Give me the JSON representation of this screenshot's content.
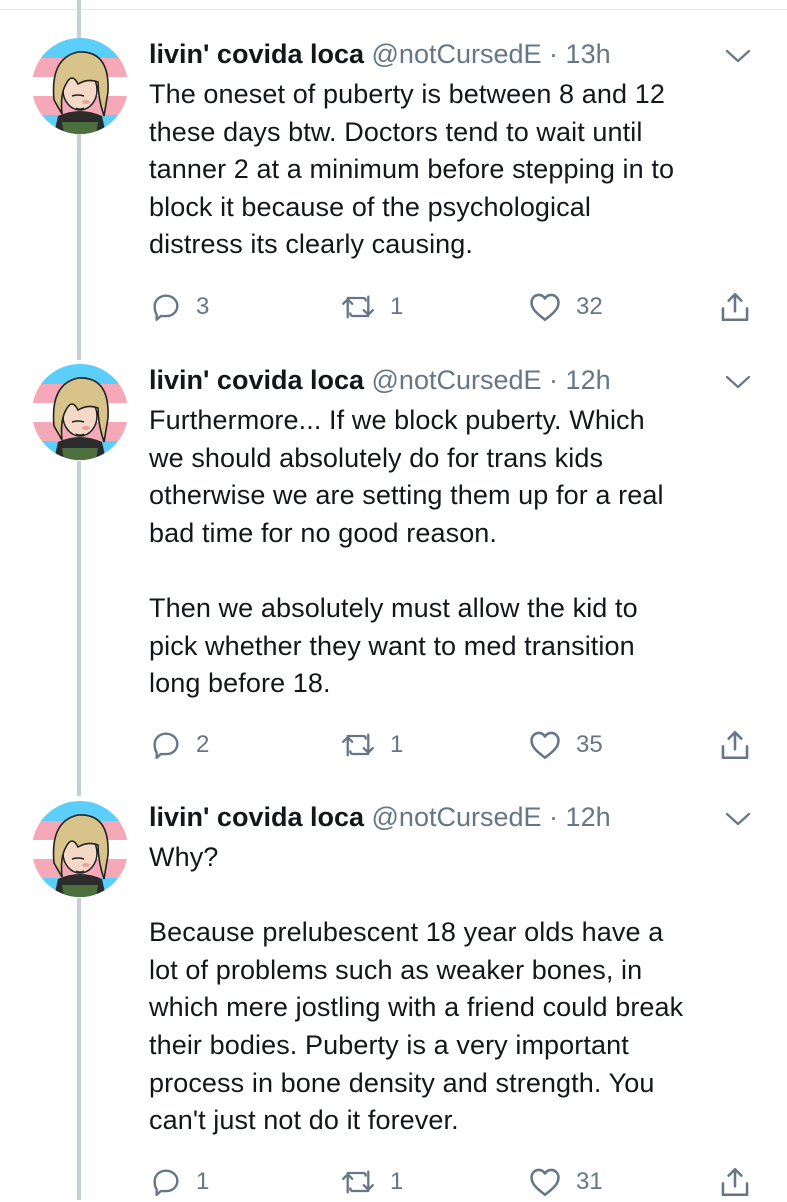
{
  "tweets": [
    {
      "name": "livin' covida loca",
      "handle": "@notCursedE",
      "separator": "·",
      "time": "13h",
      "text": "The oneset of puberty is between 8 and 12\nthese days btw. Doctors tend to wait until\ntanner 2 at a minimum before stepping in to\nblock it because of the psychological\ndistress its clearly causing.",
      "replies": "3",
      "retweets": "1",
      "likes": "32"
    },
    {
      "name": "livin' covida loca",
      "handle": "@notCursedE",
      "separator": "·",
      "time": "12h",
      "text": "Furthermore... If we block puberty. Which\nwe should absolutely do for trans kids\notherwise we are setting them up for a real\nbad time for no good reason.\n\nThen we absolutely must allow the kid to\npick whether they want to med transition\nlong before 18.",
      "replies": "2",
      "retweets": "1",
      "likes": "35"
    },
    {
      "name": "livin' covida loca",
      "handle": "@notCursedE",
      "separator": "·",
      "time": "12h",
      "text": "Why?\n\nBecause prelubescent 18 year olds have a\nlot of problems such as weaker bones, in\nwhich mere jostling with a friend could break\ntheir bodies. Puberty is a very important\nprocess in bone density and strength. You\ncan't just not do it forever.",
      "replies": "1",
      "retweets": "1",
      "likes": "31"
    }
  ],
  "icons": {
    "reply": "reply-icon",
    "retweet": "retweet-icon",
    "like": "heart-icon",
    "share": "share-icon",
    "caret": "chevron-down-icon"
  },
  "colors": {
    "text": "#14171a",
    "secondary": "#657786",
    "thread_line": "#c4cfd6",
    "flag_blue": "#5bcefa",
    "flag_pink": "#f5a9b8",
    "flag_white": "#ffffff"
  }
}
